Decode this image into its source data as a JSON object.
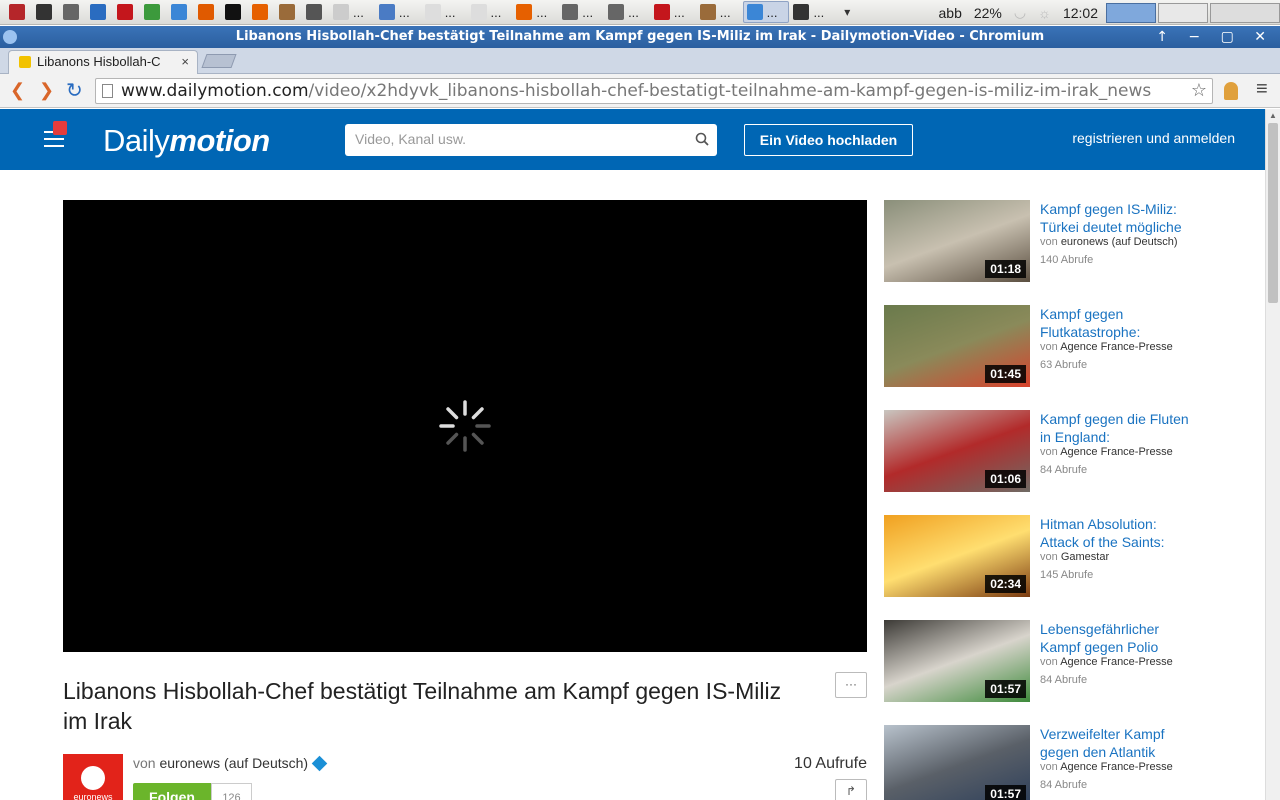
{
  "taskbar": {
    "items": [
      {
        "label": "",
        "icon": "red-app-icon",
        "color": "#b5262a"
      },
      {
        "label": "",
        "icon": "terminal-icon",
        "color": "#333333"
      },
      {
        "label": "",
        "icon": "editor-icon",
        "color": "#666666"
      },
      {
        "label": "",
        "icon": "refresh-app-icon",
        "color": "#2a6cc0"
      },
      {
        "label": "",
        "icon": "mendeley-icon",
        "color": "#c4161c"
      },
      {
        "label": "",
        "icon": "network-icon",
        "color": "#3c9a3c"
      },
      {
        "label": "",
        "icon": "chromium-icon",
        "color": "#3b86d6"
      },
      {
        "label": "",
        "icon": "x-icon",
        "color": "#e05a00"
      },
      {
        "label": "",
        "icon": "circle-a-icon",
        "color": "#111111"
      },
      {
        "label": "",
        "icon": "firefox-icon",
        "color": "#e66000"
      },
      {
        "label": "",
        "icon": "archive-icon",
        "color": "#9a6b3a"
      },
      {
        "label": "",
        "icon": "screenshot-icon",
        "color": "#555555"
      },
      {
        "label": "...",
        "icon": "document-icon",
        "color": "#cccccc"
      },
      {
        "label": "...",
        "icon": "text-icon",
        "color": "#4a7bc4"
      },
      {
        "label": "...",
        "icon": "page-icon",
        "color": "#dddddd"
      },
      {
        "label": "...",
        "icon": "page-icon",
        "color": "#dddddd"
      },
      {
        "label": "...",
        "icon": "firefox-icon",
        "color": "#e66000"
      },
      {
        "label": "...",
        "icon": "editor-icon",
        "color": "#666666"
      },
      {
        "label": "...",
        "icon": "editor-icon",
        "color": "#666666"
      },
      {
        "label": "...",
        "icon": "mendeley-icon",
        "color": "#c4161c"
      },
      {
        "label": "...",
        "icon": "archive-icon",
        "color": "#9a6b3a"
      },
      {
        "label": "...",
        "icon": "chromium-icon",
        "color": "#3b86d6",
        "active": true
      },
      {
        "label": "...",
        "icon": "terminal-icon",
        "color": "#333333"
      }
    ],
    "dropdown": "▾",
    "keyboard_layout": "abb",
    "battery": "22%",
    "clock": "12:02"
  },
  "window": {
    "title": "Libanons Hisbollah-Chef bestätigt Teilnahme am Kampf gegen IS-Miliz im Irak - Dailymotion-Video - Chromium",
    "controls": "↑ − ▢ ✕"
  },
  "tab": {
    "title": "Libanons Hisbollah-C",
    "close": "×"
  },
  "toolbar": {
    "back": "❮",
    "forward": "❯",
    "reload": "↻",
    "url_host": "www.dailymotion.com",
    "url_path": "/video/x2hdyvk_libanons-hisbollah-chef-bestatigt-teilnahme-am-kampf-gegen-is-miliz-im-irak_news",
    "star": "☆",
    "menu": "≡"
  },
  "header": {
    "logo_regular": "Daily",
    "logo_bold": "motion",
    "search_placeholder": "Video, Kanal usw.",
    "upload_label": "Ein Video hochladen",
    "login_label": "registrieren und anmelden",
    "brand_color": "#0066b4"
  },
  "video": {
    "title": "Libanons Hisbollah-Chef bestätigt Teilnahme am Kampf gegen IS-Miliz im Irak",
    "more_label": "···",
    "share_label": "↱",
    "by_prefix": "von",
    "channel": "euronews (auf Deutsch)",
    "channel_logo_text": "euronews",
    "follow_label": "Folgen",
    "followers": "126",
    "views": "10 Aufrufe"
  },
  "related": [
    {
      "title": "Kampf gegen IS-Miliz: Türkei deutet mögliche",
      "by_prefix": "von",
      "channel": "euronews (auf Deutsch)",
      "views": "140 Abrufe",
      "duration": "01:18",
      "thumb_colors": [
        "#8a8f7a",
        "#c8c0b0",
        "#5a4e40"
      ]
    },
    {
      "title": "Kampf gegen Flutkatastrophe:",
      "by_prefix": "von",
      "channel": "Agence France-Presse",
      "views": "63 Abrufe",
      "duration": "01:45",
      "thumb_colors": [
        "#6a7a4c",
        "#8a8a5a",
        "#d8422c"
      ]
    },
    {
      "title": "Kampf gegen die Fluten in England:",
      "by_prefix": "von",
      "channel": "Agence France-Presse",
      "views": "84 Abrufe",
      "duration": "01:06",
      "thumb_colors": [
        "#c9c6c0",
        "#b22a2a",
        "#6f6a64"
      ]
    },
    {
      "title": "Hitman Absolution: Attack of the Saints:",
      "by_prefix": "von",
      "channel": "Gamestar",
      "views": "145 Abrufe",
      "duration": "02:34",
      "thumb_colors": [
        "#f0a020",
        "#ffde70",
        "#7a3a10"
      ]
    },
    {
      "title": "Lebensgefährlicher Kampf gegen Polio",
      "by_prefix": "von",
      "channel": "Agence France-Presse",
      "views": "84 Abrufe",
      "duration": "01:57",
      "thumb_colors": [
        "#3c3a36",
        "#d8d4cc",
        "#3d8a3a"
      ]
    },
    {
      "title": "Verzweifelter Kampf gegen den Atlantik",
      "by_prefix": "von",
      "channel": "Agence France-Presse",
      "views": "84 Abrufe",
      "duration": "01:57",
      "thumb_colors": [
        "#b8c2cc",
        "#5a6068",
        "#2c3e5a"
      ]
    }
  ]
}
